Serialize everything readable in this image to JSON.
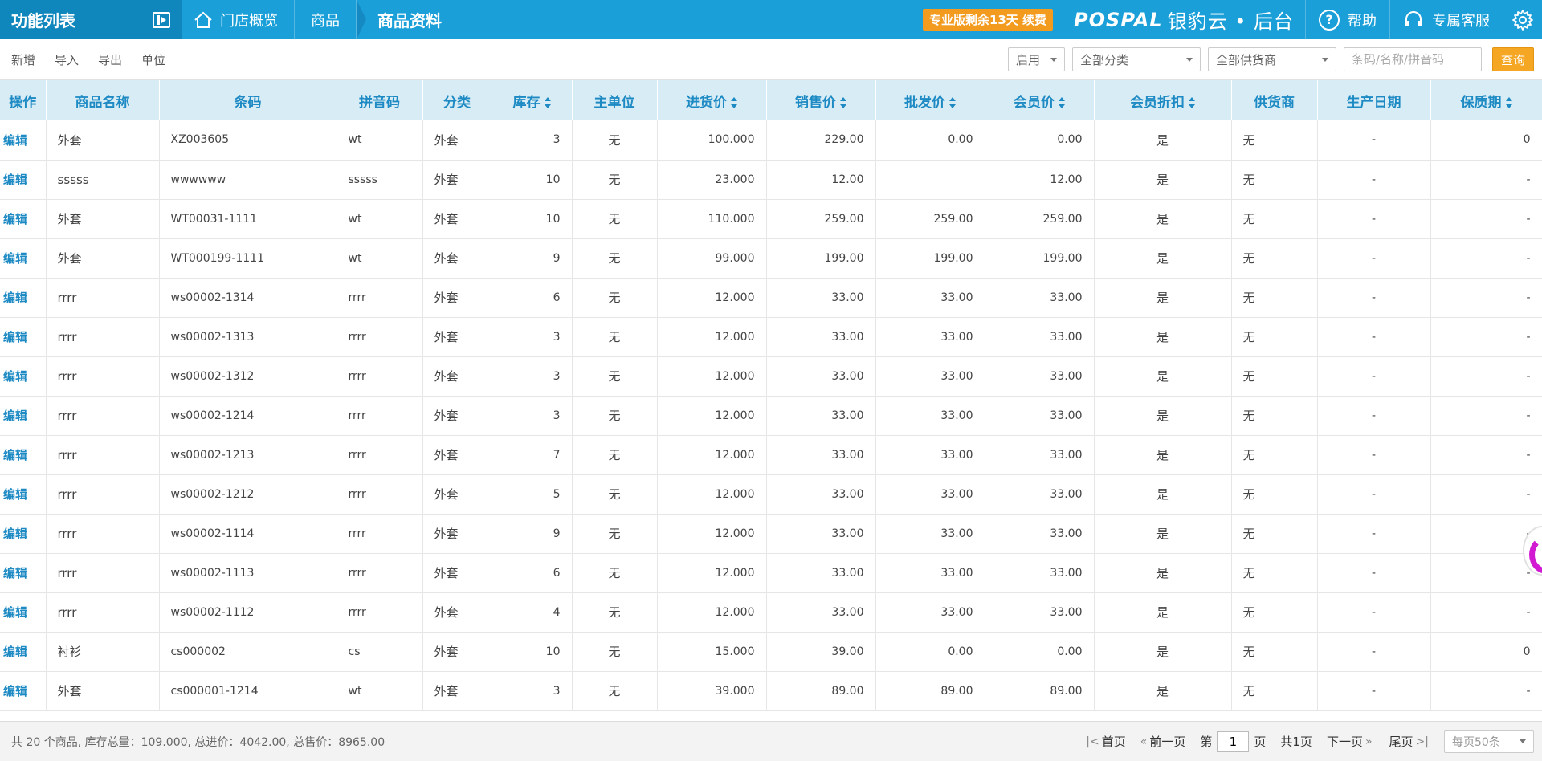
{
  "header": {
    "function_list": "功能列表",
    "breadcrumbs": [
      "门店概览",
      "商品",
      "商品资料"
    ],
    "promo": "专业版剩余13天 续费",
    "logo_latin": "POSPAL",
    "logo_cn": "银豹云 • 后台",
    "help": "帮助",
    "service": "专属客服"
  },
  "toolbar": {
    "actions": [
      "新增",
      "导入",
      "导出",
      "单位"
    ],
    "status_filter": "启用",
    "category_filter": "全部分类",
    "supplier_filter": "全部供货商",
    "search_placeholder": "条码/名称/拼音码",
    "query": "查询"
  },
  "table": {
    "columns": [
      "操作",
      "商品名称",
      "条码",
      "拼音码",
      "分类",
      "库存",
      "主单位",
      "进货价",
      "销售价",
      "批发价",
      "会员价",
      "会员折扣",
      "供货商",
      "生产日期",
      "保质期"
    ],
    "edit_label": "编辑",
    "rows": [
      [
        "外套",
        "XZ003605",
        "wt",
        "外套",
        "3",
        "无",
        "100.000",
        "229.00",
        "0.00",
        "0.00",
        "是",
        "无",
        "-",
        "0"
      ],
      [
        "sssss",
        "wwwwww",
        "sssss",
        "外套",
        "10",
        "无",
        "23.000",
        "12.00",
        "",
        "12.00",
        "是",
        "无",
        "-",
        "-"
      ],
      [
        "外套",
        "WT00031-1111",
        "wt",
        "外套",
        "10",
        "无",
        "110.000",
        "259.00",
        "259.00",
        "259.00",
        "是",
        "无",
        "-",
        "-"
      ],
      [
        "外套",
        "WT000199-1111",
        "wt",
        "外套",
        "9",
        "无",
        "99.000",
        "199.00",
        "199.00",
        "199.00",
        "是",
        "无",
        "-",
        "-"
      ],
      [
        "rrrr",
        "ws00002-1314",
        "rrrr",
        "外套",
        "6",
        "无",
        "12.000",
        "33.00",
        "33.00",
        "33.00",
        "是",
        "无",
        "-",
        "-"
      ],
      [
        "rrrr",
        "ws00002-1313",
        "rrrr",
        "外套",
        "3",
        "无",
        "12.000",
        "33.00",
        "33.00",
        "33.00",
        "是",
        "无",
        "-",
        "-"
      ],
      [
        "rrrr",
        "ws00002-1312",
        "rrrr",
        "外套",
        "3",
        "无",
        "12.000",
        "33.00",
        "33.00",
        "33.00",
        "是",
        "无",
        "-",
        "-"
      ],
      [
        "rrrr",
        "ws00002-1214",
        "rrrr",
        "外套",
        "3",
        "无",
        "12.000",
        "33.00",
        "33.00",
        "33.00",
        "是",
        "无",
        "-",
        "-"
      ],
      [
        "rrrr",
        "ws00002-1213",
        "rrrr",
        "外套",
        "7",
        "无",
        "12.000",
        "33.00",
        "33.00",
        "33.00",
        "是",
        "无",
        "-",
        "-"
      ],
      [
        "rrrr",
        "ws00002-1212",
        "rrrr",
        "外套",
        "5",
        "无",
        "12.000",
        "33.00",
        "33.00",
        "33.00",
        "是",
        "无",
        "-",
        "-"
      ],
      [
        "rrrr",
        "ws00002-1114",
        "rrrr",
        "外套",
        "9",
        "无",
        "12.000",
        "33.00",
        "33.00",
        "33.00",
        "是",
        "无",
        "-",
        "-"
      ],
      [
        "rrrr",
        "ws00002-1113",
        "rrrr",
        "外套",
        "6",
        "无",
        "12.000",
        "33.00",
        "33.00",
        "33.00",
        "是",
        "无",
        "-",
        "-"
      ],
      [
        "rrrr",
        "ws00002-1112",
        "rrrr",
        "外套",
        "4",
        "无",
        "12.000",
        "33.00",
        "33.00",
        "33.00",
        "是",
        "无",
        "-",
        "-"
      ],
      [
        "衬衫",
        "cs000002",
        "cs",
        "外套",
        "10",
        "无",
        "15.000",
        "39.00",
        "0.00",
        "0.00",
        "是",
        "无",
        "-",
        "0"
      ],
      [
        "外套",
        "cs000001-1214",
        "wt",
        "外套",
        "3",
        "无",
        "39.000",
        "89.00",
        "89.00",
        "89.00",
        "是",
        "无",
        "-",
        "-"
      ]
    ]
  },
  "footer": {
    "summary": "共 20 个商品, 库存总量：109.000, 总进价：4042.00, 总售价：8965.00",
    "first": "首页",
    "prev": "前一页",
    "page_prefix": "第",
    "page_value": "1",
    "page_suffix": "页",
    "total_pages": "共1页",
    "next": "下一页",
    "last": "尾页",
    "per_page": "每页50条"
  },
  "colors": {
    "topbar": "#1a9fd8",
    "header_row": "#d8ecf5",
    "accent_blue": "#1d8ac4",
    "query_button": "#f5a623",
    "promo": "#f29b1f"
  }
}
